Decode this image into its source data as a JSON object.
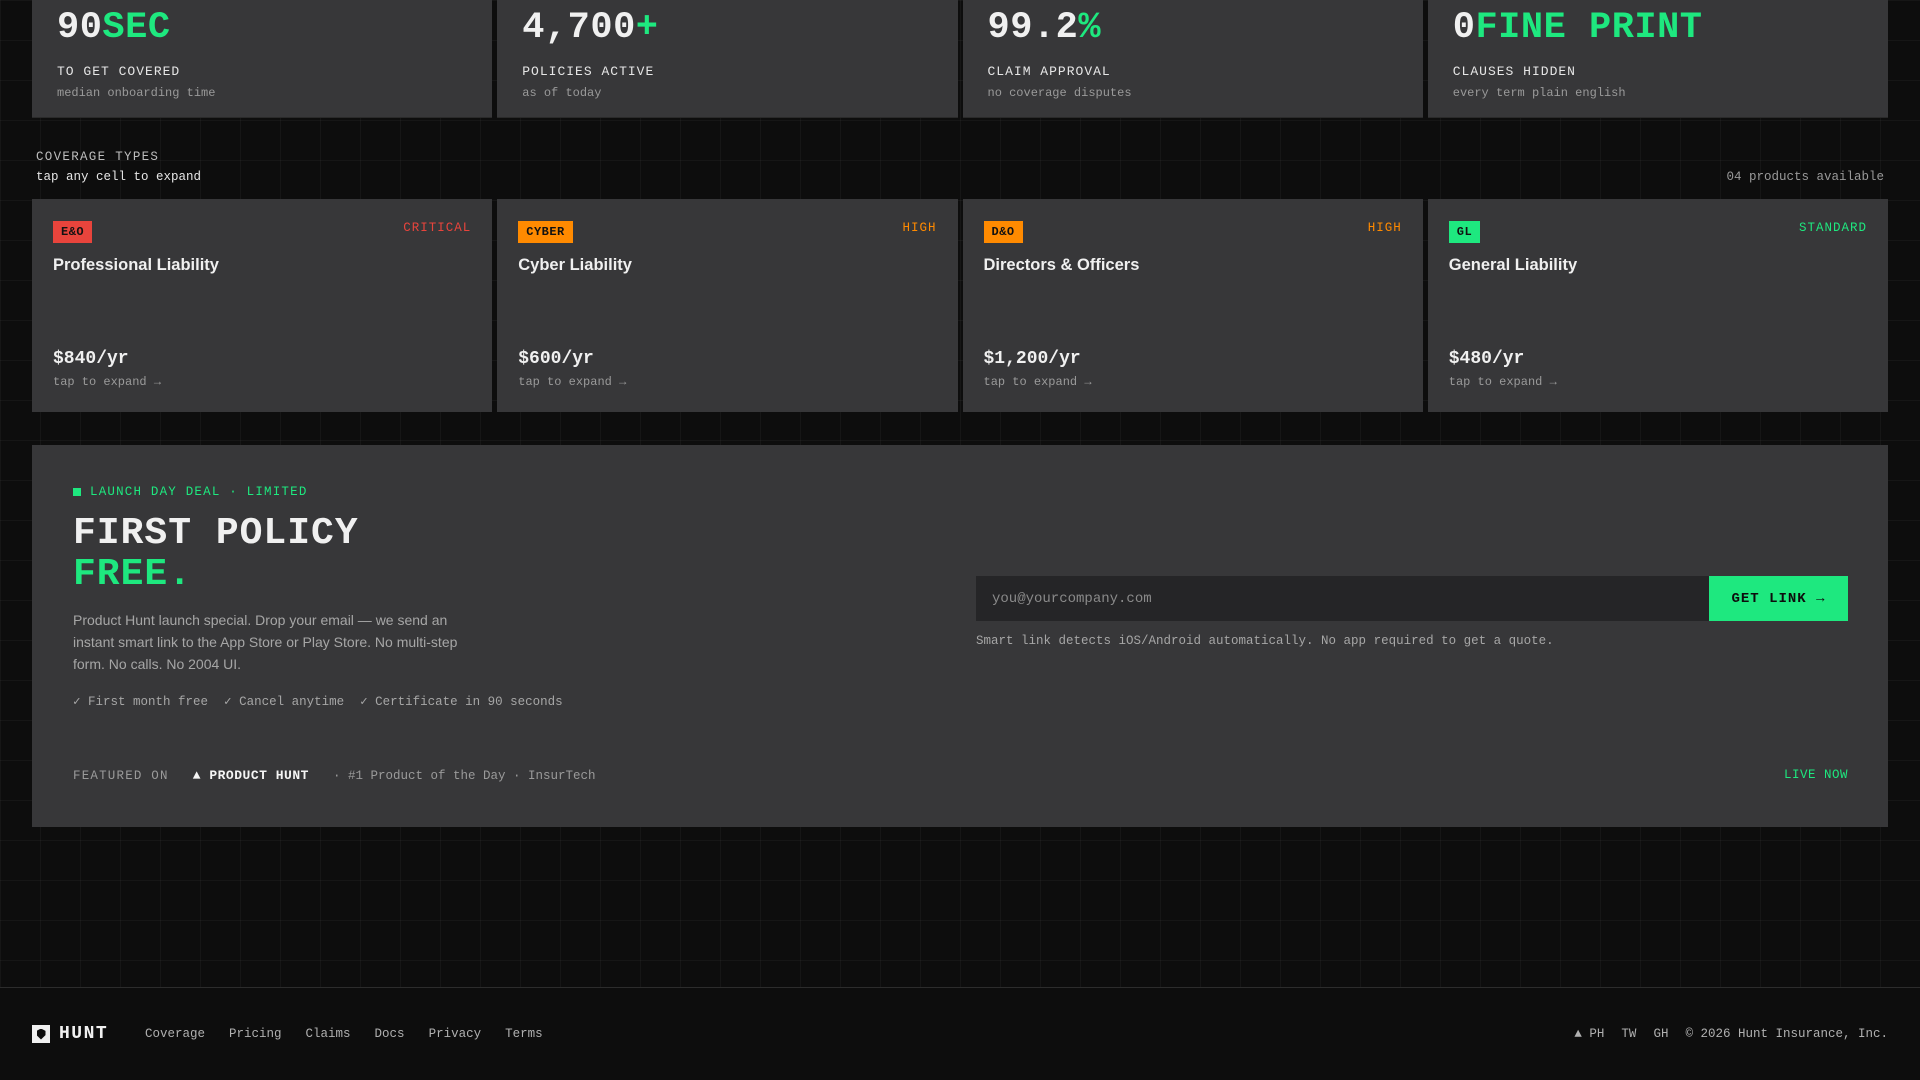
{
  "colors": {
    "accent": "#1ee87f",
    "critical": "#e8443c",
    "high": "#ff8a00",
    "standard": "#1ee87f",
    "panel": "#373739",
    "background": "#0d0d0d"
  },
  "stats": [
    {
      "value_main": "90",
      "value_accent": "SEC",
      "label": "TO GET COVERED",
      "sub": "median onboarding time"
    },
    {
      "value_main": "4,700",
      "value_accent": "+",
      "label": "POLICIES ACTIVE",
      "sub": "as of today"
    },
    {
      "value_main": "99.2",
      "value_accent": "%",
      "label": "CLAIM APPROVAL",
      "sub": "no coverage disputes"
    },
    {
      "value_main": "0",
      "value_accent": "FINE PRINT",
      "label": "CLAUSES HIDDEN",
      "sub": "every term plain english"
    }
  ],
  "coverage": {
    "title": "COVERAGE TYPES",
    "hint": "tap any cell to expand",
    "count": "04 products available",
    "cards": [
      {
        "badge": "E&O",
        "badge_color": "#e8443c",
        "level": "CRITICAL",
        "level_color": "#e8443c",
        "name": "Professional Liability",
        "price": "$840/yr",
        "expand": "tap to expand →"
      },
      {
        "badge": "CYBER",
        "badge_color": "#ff8a00",
        "level": "HIGH",
        "level_color": "#ff8a00",
        "name": "Cyber Liability",
        "price": "$600/yr",
        "expand": "tap to expand →"
      },
      {
        "badge": "D&O",
        "badge_color": "#ff8a00",
        "level": "HIGH",
        "level_color": "#ff8a00",
        "name": "Directors & Officers",
        "price": "$1,200/yr",
        "expand": "tap to expand →"
      },
      {
        "badge": "GL",
        "badge_color": "#1ee87f",
        "level": "STANDARD",
        "level_color": "#1ee87f",
        "name": "General Liability",
        "price": "$480/yr",
        "expand": "tap to expand →"
      }
    ]
  },
  "promo": {
    "tag": "LAUNCH DAY DEAL · LIMITED",
    "heading_line1": "FIRST POLICY",
    "heading_line2": "FREE.",
    "description": "Product Hunt launch special. Drop your email — we send an instant smart link to the App Store or Play Store. No multi-step form. No calls. No 2004 UI.",
    "checks": [
      "✓ First month free",
      "✓ Cancel anytime",
      "✓ Certificate in 90 seconds"
    ],
    "email_placeholder": "you@yourcompany.com",
    "email_value": "",
    "button_label": "GET LINK →",
    "note": "Smart link detects iOS/Android automatically. No app required to get a quote.",
    "featured_label": "FEATURED ON",
    "featured_logo": "▲ PRODUCT HUNT",
    "featured_desc": "· #1 Product of the Day · InsurTech",
    "live": "LIVE NOW"
  },
  "footer": {
    "brand": "HUNT",
    "nav": [
      "Coverage",
      "Pricing",
      "Claims",
      "Docs",
      "Privacy",
      "Terms"
    ],
    "social": [
      "▲ PH",
      "TW",
      "GH"
    ],
    "copyright": "© 2026 Hunt Insurance, Inc."
  }
}
